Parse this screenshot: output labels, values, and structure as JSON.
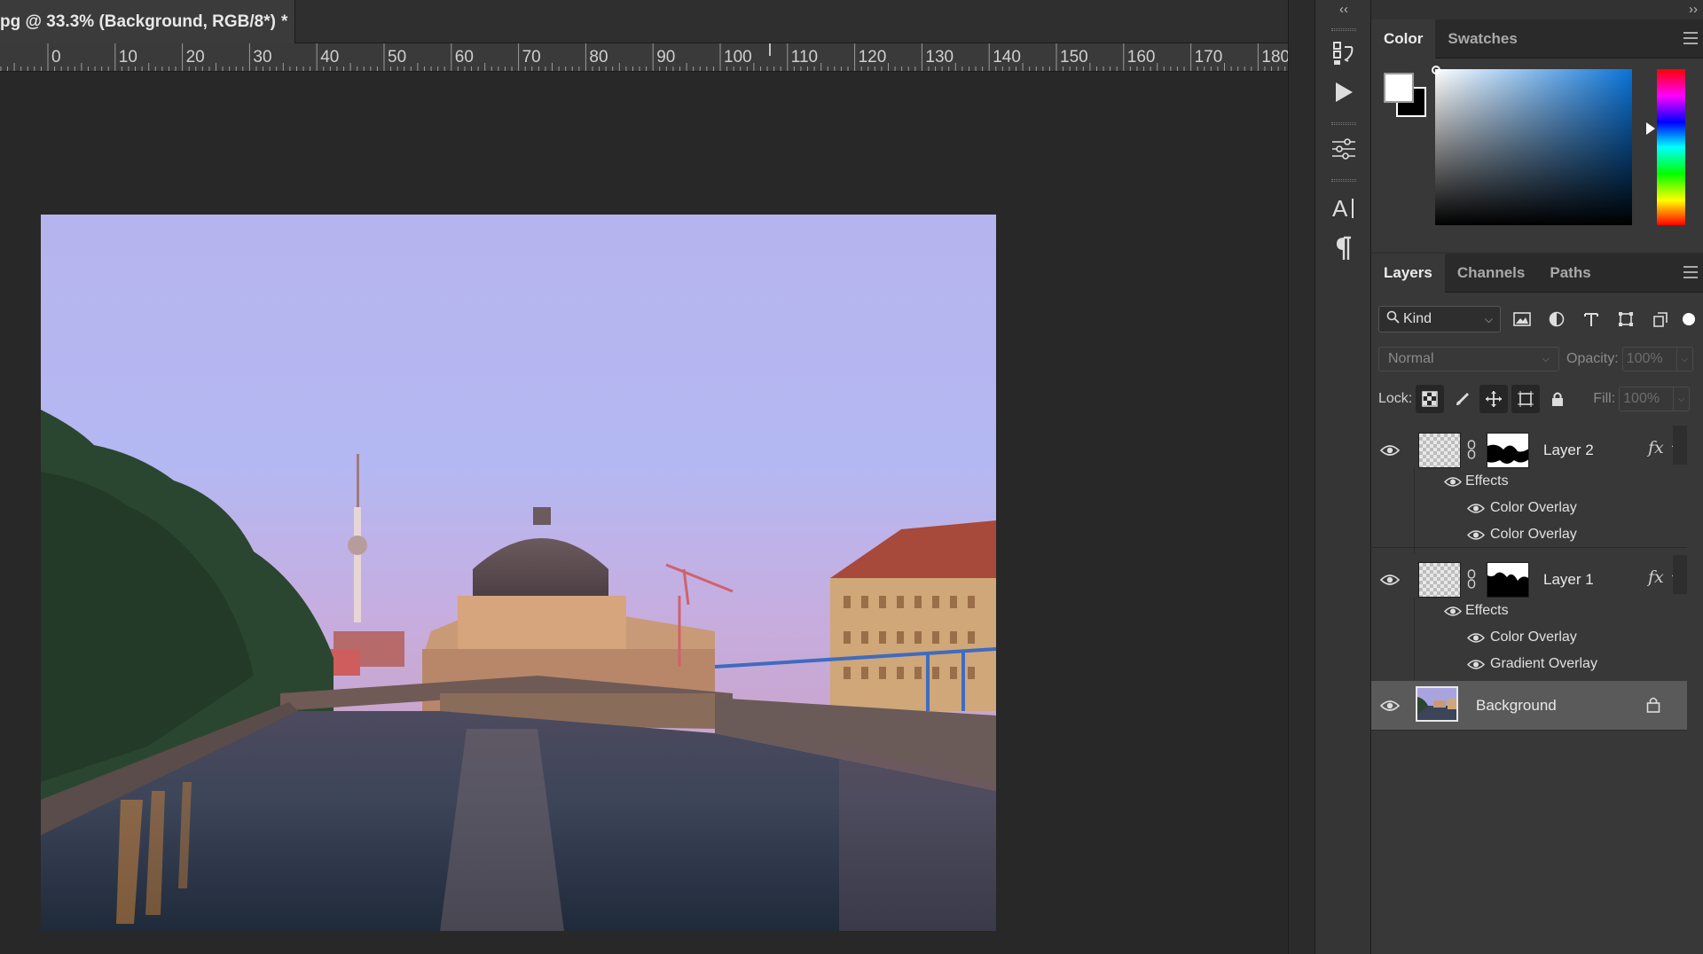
{
  "document_tab": {
    "title": "pg @ 33.3% (Background, RGB/8*)",
    "modified": "*"
  },
  "ruler": {
    "labels": [
      "0",
      "10",
      "20",
      "30",
      "40",
      "50",
      "60",
      "70",
      "80",
      "90",
      "100",
      "110",
      "120",
      "130",
      "140",
      "150",
      "160",
      "170",
      "180"
    ]
  },
  "tools_panel": {
    "collapse": "‹‹",
    "buttons": [
      "history-icon",
      "play-action-icon",
      "properties-sliders-icon",
      "character-icon",
      "paragraph-icon"
    ]
  },
  "color_panel": {
    "collapse": "››",
    "tabs": [
      "Color",
      "Swatches"
    ],
    "foreground_color": "#ffffff",
    "background_color": "#000000",
    "hue_color": "#0a73d8"
  },
  "layers_panel": {
    "tabs": [
      "Layers",
      "Channels",
      "Paths"
    ],
    "filter": {
      "kind_label": "Kind"
    },
    "blend_mode": "Normal",
    "opacity_label": "Opacity:",
    "opacity_value": "100%",
    "lock_label": "Lock:",
    "fill_label": "Fill:",
    "fill_value": "100%",
    "layers": [
      {
        "name": "Layer 2",
        "fx": "fx",
        "effects_label": "Effects",
        "effects": [
          "Color Overlay",
          "Color Overlay"
        ]
      },
      {
        "name": "Layer 1",
        "fx": "fx",
        "effects_label": "Effects",
        "effects": [
          "Color Overlay",
          "Gradient Overlay"
        ]
      },
      {
        "name": "Background",
        "locked": true
      }
    ]
  }
}
